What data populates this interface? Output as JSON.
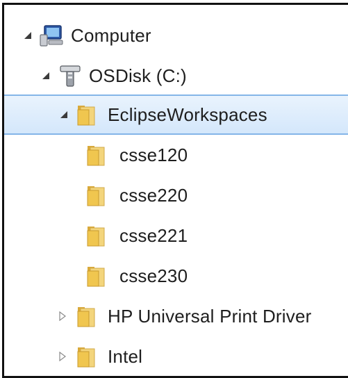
{
  "tree": {
    "computer": {
      "label": "Computer",
      "icon": "computer-icon",
      "state": "expanded"
    },
    "osdisk": {
      "label": "OSDisk (C:)",
      "icon": "drive-icon",
      "state": "expanded"
    },
    "eclipse": {
      "label": "EclipseWorkspaces",
      "icon": "folder-icon",
      "state": "expanded",
      "selected": true
    },
    "children": [
      {
        "label": "csse120",
        "icon": "folder-icon"
      },
      {
        "label": "csse220",
        "icon": "folder-icon"
      },
      {
        "label": "csse221",
        "icon": "folder-icon"
      },
      {
        "label": "csse230",
        "icon": "folder-icon"
      }
    ],
    "hp": {
      "label": "HP Universal Print Driver",
      "icon": "folder-icon",
      "state": "collapsed"
    },
    "intel": {
      "label": "Intel",
      "icon": "folder-icon",
      "state": "collapsed"
    }
  },
  "colors": {
    "selection_fill": "#dbeafb",
    "selection_border": "#84b5e8",
    "folder_yellow": "#f2cf5a"
  }
}
